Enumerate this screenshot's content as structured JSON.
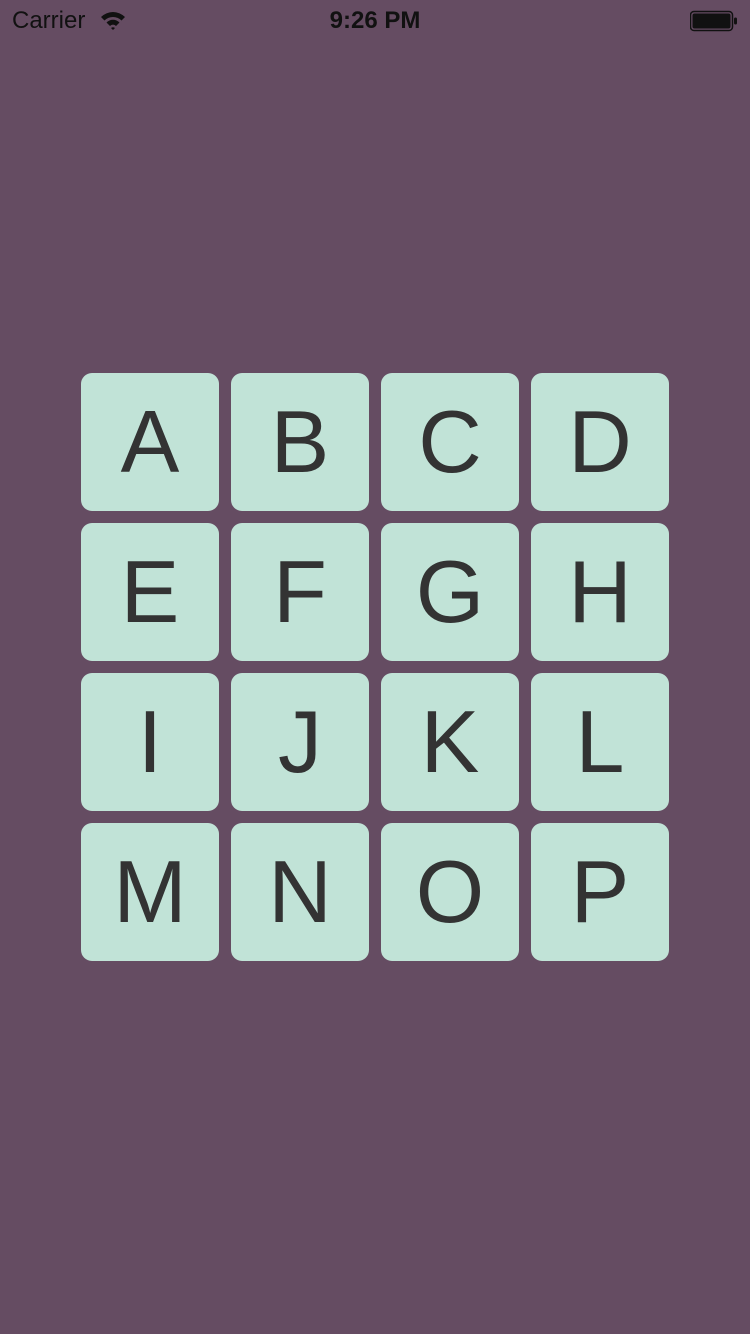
{
  "status_bar": {
    "carrier": "Carrier",
    "time": "9:26 PM",
    "icons": [
      "wifi-icon",
      "battery-icon"
    ]
  },
  "colors": {
    "background": "#654c62",
    "tile": "#c1e3d7",
    "tile_text": "#333333"
  },
  "grid": {
    "tiles": [
      "A",
      "B",
      "C",
      "D",
      "E",
      "F",
      "G",
      "H",
      "I",
      "J",
      "K",
      "L",
      "M",
      "N",
      "O",
      "P"
    ]
  }
}
